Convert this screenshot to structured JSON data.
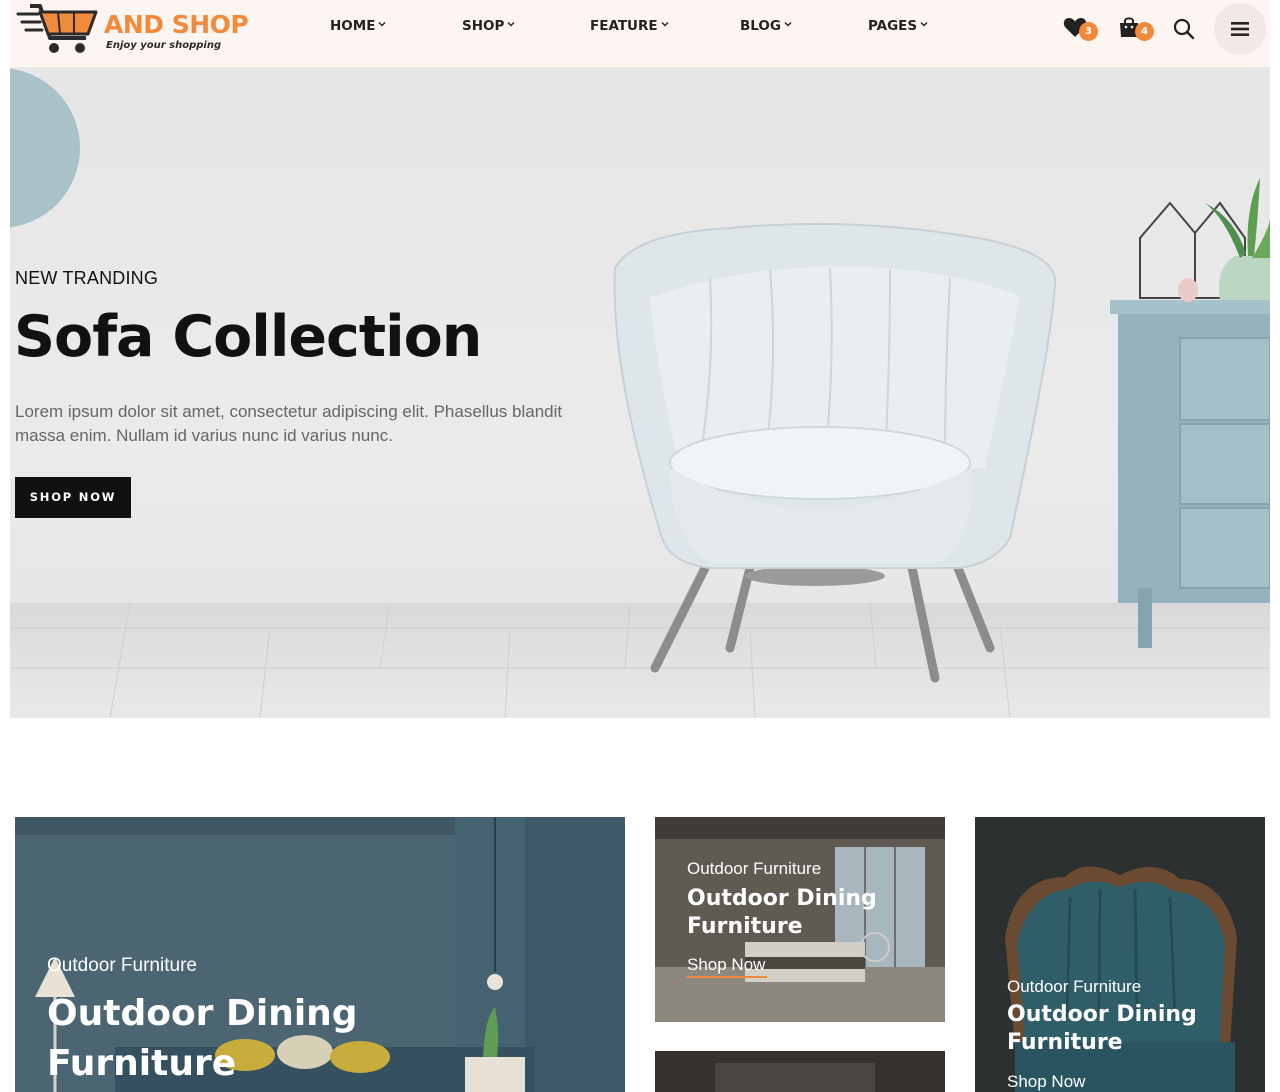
{
  "brand": {
    "name": "AND SHOP",
    "tagline": "Enjoy your shopping",
    "accent_color": "#f28a3c",
    "logo_icon": "shopping-cart-icon"
  },
  "nav": {
    "items": [
      {
        "label": "HOME"
      },
      {
        "label": "SHOP"
      },
      {
        "label": "FEATURE"
      },
      {
        "label": "BLOG"
      },
      {
        "label": "PAGES"
      }
    ],
    "dropdown_icon": "chevron-down-icon"
  },
  "header_actions": {
    "wishlist": {
      "icon": "heart-icon",
      "count": "3"
    },
    "cart": {
      "icon": "shopping-bag-icon",
      "count": "4"
    },
    "search": {
      "icon": "search-icon"
    },
    "menu": {
      "icon": "hamburger-menu-icon"
    }
  },
  "hero": {
    "eyebrow": "NEW TRANDING",
    "title": "Sofa Collection",
    "description": "Lorem ipsum dolor sit amet, consectetur adipiscing elit. Phasellus blandit massa enim. Nullam id varius nunc id varius nunc.",
    "button_label": "SHOP NOW"
  },
  "banners": [
    {
      "subtitle": "Outdoor Furniture",
      "title_line1": "Outdoor Dining",
      "title_line2": "Furniture",
      "link": ""
    },
    {
      "subtitle": "Outdoor Furniture",
      "title_line1": "Outdoor Dining",
      "title_line2": "Furniture",
      "link": "Shop Now"
    },
    {
      "subtitle": "Outdoor Furniture",
      "title_line1": "Outdoor Dining",
      "title_line2": "Furniture",
      "link": "Shop Now"
    }
  ]
}
